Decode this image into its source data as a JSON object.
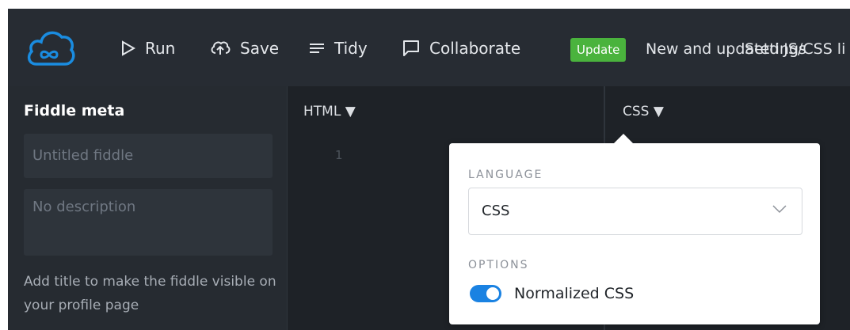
{
  "toolbar": {
    "run_label": "Run",
    "save_label": "Save",
    "tidy_label": "Tidy",
    "collaborate_label": "Collaborate",
    "update_badge": "Update",
    "news_text": "New and updated JS/CSS li",
    "settings_label": "Settings"
  },
  "sidebar": {
    "title": "Fiddle meta",
    "title_placeholder": "Untitled fiddle",
    "description_placeholder": "No description",
    "hint": "Add title to make the fiddle visible on your profile page"
  },
  "panels": {
    "html_label": "HTML ▼",
    "css_label": "CSS ▼",
    "line_number": "1"
  },
  "popover": {
    "language_heading": "LANGUAGE",
    "language_value": "CSS",
    "options_heading": "OPTIONS",
    "normalized_label": "Normalized CSS",
    "normalized_on": true
  },
  "colors": {
    "accent": "#1a82e2",
    "update_green": "#4ab33d",
    "topbar": "#272c33",
    "logo_blue": "#1a8ce0"
  }
}
